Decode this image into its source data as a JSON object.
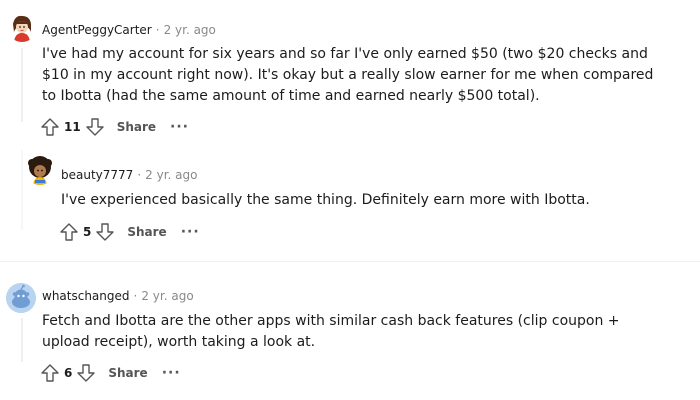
{
  "comments": [
    {
      "username": "AgentPeggyCarter",
      "time": "2 yr. ago",
      "body": "I've had my account for six years and so far I've only earned $50 (two $20 checks and $10 in my account right now). It's okay but a really slow earner for me when compared to Ibotta (had the same amount of time and earned nearly $500 total).",
      "votes": "11",
      "share": "Share",
      "more": "···"
    },
    {
      "username": "beauty7777",
      "time": "2 yr. ago",
      "body": "I've experienced basically the same thing. Definitely earn more with Ibotta.",
      "votes": "5",
      "share": "Share",
      "more": "···"
    },
    {
      "username": "whatschanged",
      "time": "2 yr. ago",
      "body": "Fetch and Ibotta are the other apps with similar cash back features (clip coupon + upload receipt), worth taking a look at.",
      "votes": "6",
      "share": "Share",
      "more": "···"
    }
  ],
  "separator": "·",
  "icons": {
    "upvote": "upvote-icon",
    "downvote": "downvote-icon"
  },
  "colors": {
    "text": "#1c1c1c",
    "meta": "#878a8c",
    "action": "#555555"
  }
}
